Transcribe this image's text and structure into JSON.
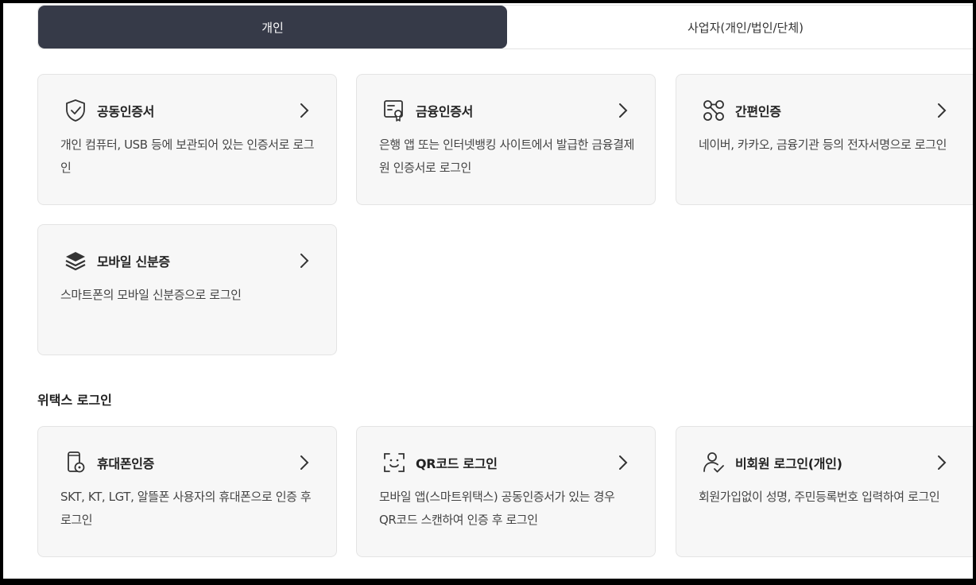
{
  "tabs": [
    {
      "label": "개인",
      "active": true
    },
    {
      "label": "사업자(개인/법인/단체)",
      "active": false
    }
  ],
  "personal_cards": [
    {
      "icon": "shield-check-icon",
      "title": "공동인증서",
      "desc": "개인 컴퓨터, USB 등에 보관되어 있는 인증서로 로그인"
    },
    {
      "icon": "certificate-icon",
      "title": "금융인증서",
      "desc": "은행 앱 또는 인터넷뱅킹 사이트에서 발급한 금융결제원 인증서로 로그인"
    },
    {
      "icon": "linked-nodes-icon",
      "title": "간편인증",
      "desc": "네이버, 카카오, 금융기관 등의 전자서명으로 로그인"
    },
    {
      "icon": "layers-icon",
      "title": "모바일 신분증",
      "desc": "스마트폰의 모바일 신분증으로 로그인"
    }
  ],
  "wetax_section": {
    "title": "위택스 로그인",
    "cards": [
      {
        "icon": "phone-lock-icon",
        "title": "휴대폰인증",
        "desc": "SKT, KT, LGT, 알뜰폰 사용자의 휴대폰으로 인증 후 로그인"
      },
      {
        "icon": "qr-scan-icon",
        "title": "QR코드 로그인",
        "desc": "모바일 앱(스마트위택스) 공동인증서가 있는 경우 QR코드 스캔하여 인증 후 로그인"
      },
      {
        "icon": "user-check-icon",
        "title": "비회원 로그인(개인)",
        "desc": "회원가입없이 성명, 주민등록번호 입력하여 로그인"
      }
    ]
  },
  "colors": {
    "active_tab": "#363a48",
    "card_bg": "#f7f7f7"
  }
}
